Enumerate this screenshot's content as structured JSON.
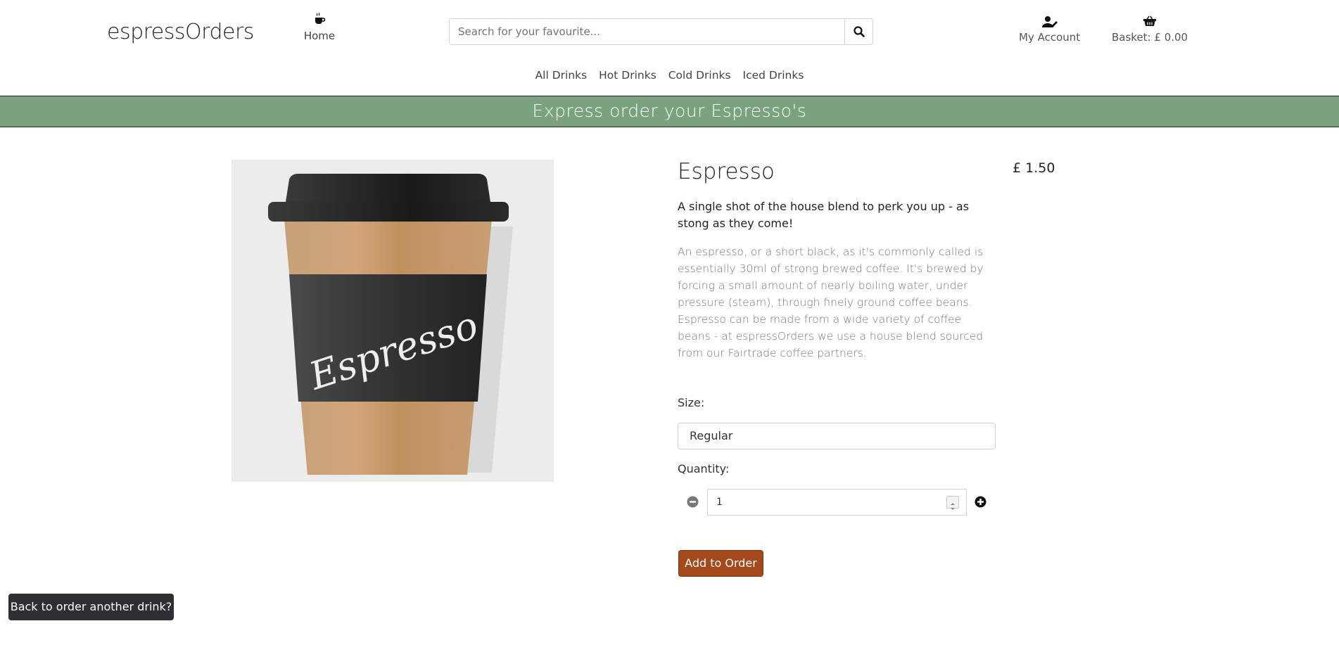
{
  "header": {
    "logo": "espressOrders",
    "home_label": "Home",
    "search_placeholder": "Search for your favourite...",
    "account_label": "My Account",
    "basket_label": "Basket: £ 0.00"
  },
  "category_nav": [
    "All Drinks",
    "Hot Drinks",
    "Cold Drinks",
    "Iced Drinks"
  ],
  "banner": "Express order your Espresso's",
  "product": {
    "name": "Espresso",
    "price": "£ 1.50",
    "tagline": "A single shot of the house blend to perk you up - as stong as they come!",
    "description": "An espresso, or a short black, as it's commonly called is essentially 30ml of strong brewed coffee. It's brewed by forcing a small amount of nearly boiling water, under pressure (steam), through finely ground coffee beans. Espresso can be made from a wide variety of coffee beans - at espressOrders we use a house blend sourced from our Fairtrade coffee partners.",
    "cup_label": "Espresso",
    "size_label": "Size:",
    "size_value": "Regular",
    "quantity_label": "Quantity:",
    "quantity_value": "1",
    "add_button": "Add to Order"
  },
  "back_button": "Back to order another drink?",
  "colors": {
    "banner": "#7ba27f",
    "add_button": "#a4491c",
    "back_button": "#2c3034"
  },
  "icons": {
    "home": "coffee-cup-icon",
    "search": "search-icon",
    "account": "user-edit-icon",
    "basket": "shopping-basket-icon",
    "minus": "minus-circle-icon",
    "plus": "plus-circle-icon"
  }
}
